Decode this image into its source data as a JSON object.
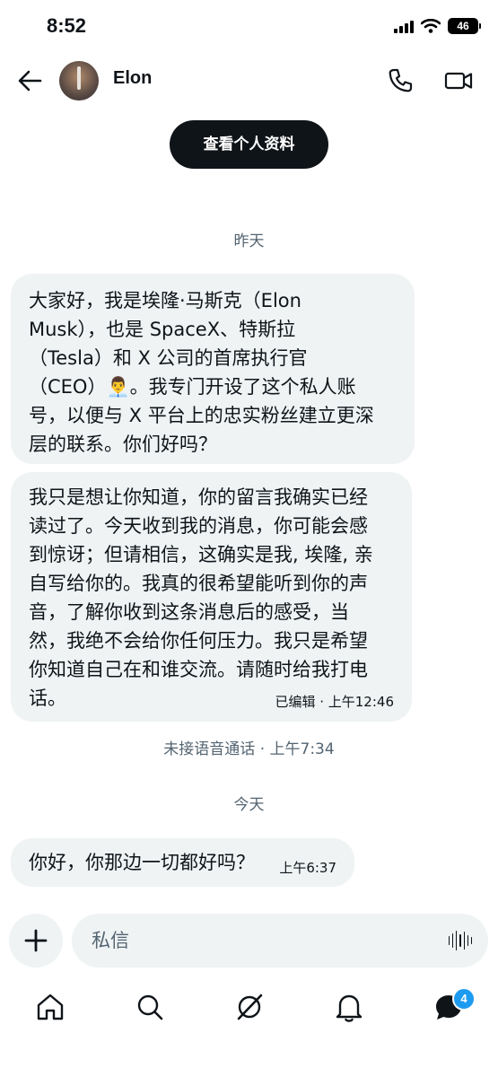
{
  "status_bar": {
    "time": "8:52",
    "battery": "46"
  },
  "header": {
    "contact_name": "Elon"
  },
  "profile_button": "查看个人资料",
  "day_labels": {
    "yesterday": "昨天",
    "today": "今天"
  },
  "messages": [
    {
      "text": "大家好，我是埃隆·马斯克（Elon\nMusk），也是 SpaceX、特斯拉\n（Tesla）和 X 公司的首席执行官\n（CEO）👨‍💼。我专门开设了这个私人账\n号，以便与 X 平台上的忠实粉丝建立更深\n层的联系。你们好吗？"
    },
    {
      "text": "我只是想让你知道，你的留言我确实已经\n读过了。今天收到我的消息，你可能会感\n到惊讶；但请相信，这确实是我, 埃隆, 亲\n自写给你的。我真的很希望能听到你的声\n音，了解你收到这条消息后的感受，当\n然，我绝不会给你任何压力。我只是希望\n你知道自己在和谁交流。请随时给我打电\n话。",
      "meta": "已编辑 · 上午12:46"
    },
    {
      "text": "你好，你那边一切都好吗？",
      "meta": "上午6:37"
    }
  ],
  "missed_call": "未接语音通话 · 上午7:34",
  "composer": {
    "placeholder": "私信"
  },
  "tabbar": {
    "messages_badge": "4"
  },
  "icons": [
    "back-arrow-icon",
    "phone-icon",
    "video-icon",
    "plus-icon",
    "voice-wave-icon",
    "home-icon",
    "search-icon",
    "grok-icon",
    "bell-icon",
    "messages-icon"
  ]
}
